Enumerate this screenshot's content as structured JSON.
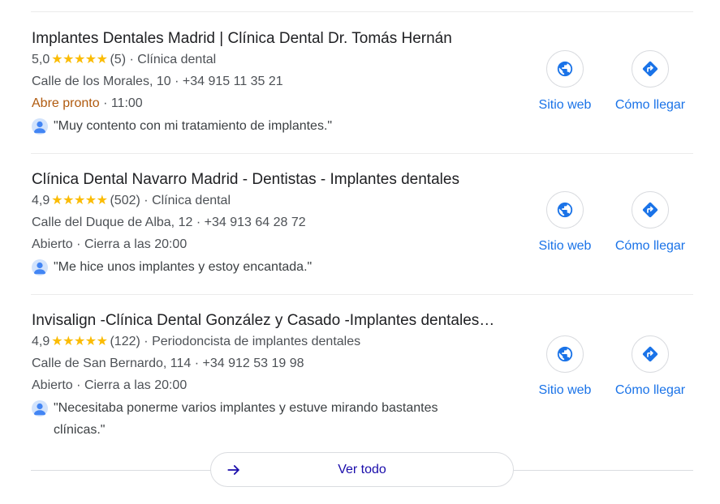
{
  "listings": [
    {
      "name": "Implantes Dentales Madrid | Clínica Dental Dr. Tomás Hernán",
      "rating": "5,0",
      "stars": "★★★★★",
      "reviews": "(5)",
      "category": "Clínica dental",
      "address": "Calle de los Morales, 10",
      "phone": "+34 915 11 35 21",
      "hours_status": "Abre pronto",
      "hours_detail": "11:00",
      "review": "\"Muy contento con mi tratamiento de implantes.\"",
      "website_label": "Sitio web",
      "directions_label": "Cómo llegar"
    },
    {
      "name": "Clínica Dental Navarro Madrid - Dentistas - Implantes dentales",
      "rating": "4,9",
      "stars": "★★★★★",
      "reviews": "(502)",
      "category": "Clínica dental",
      "address": "Calle del Duque de Alba, 12",
      "phone": "+34 913 64 28 72",
      "hours_status": "Abierto",
      "hours_detail": "Cierra a las 20:00",
      "review": "\"Me hice unos implantes y estoy encantada.\"",
      "website_label": "Sitio web",
      "directions_label": "Cómo llegar"
    },
    {
      "name": "Invisalign -Clínica Dental González y Casado -Implantes dentales…",
      "rating": "4,9",
      "stars": "★★★★★",
      "reviews": "(122)",
      "category": "Periodoncista de implantes dentales",
      "address": "Calle de San Bernardo, 114",
      "phone": "+34 912 53 19 98",
      "hours_status": "Abierto",
      "hours_detail": "Cierra a las 20:00",
      "review": "\"Necesitaba ponerme varios implantes y estuve mirando bastantes clínicas.\"",
      "website_label": "Sitio web",
      "directions_label": "Cómo llegar"
    }
  ],
  "separator": "·",
  "see_all": {
    "label": "Ver todo"
  },
  "icons": {
    "website": "globe-icon",
    "directions": "directions-icon",
    "reviewer": "avatar-icon",
    "see_all": "arrow-right-icon"
  },
  "colors": {
    "link_blue": "#1a73e8",
    "see_all_text": "#1a0dab",
    "star_yellow": "#fbbc04",
    "opening_soon": "#b05a0e"
  }
}
